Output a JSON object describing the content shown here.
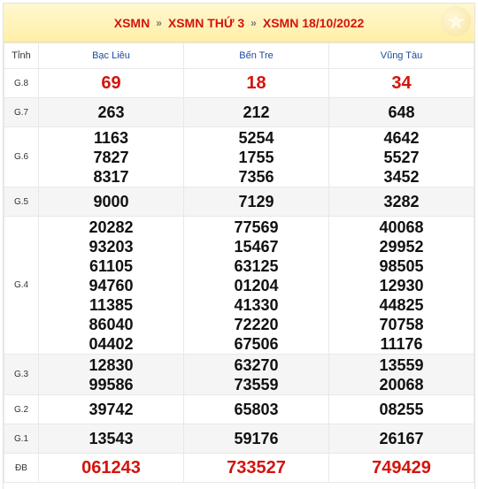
{
  "breadcrumb": {
    "items": [
      "XSMN",
      "XSMN THỨ 3",
      "XSMN 18/10/2022"
    ],
    "separator": "»"
  },
  "table": {
    "header_label": "Tỉnh",
    "provinces": [
      "Bạc Liêu",
      "Bến Tre",
      "Vũng Tàu"
    ],
    "rows": [
      {
        "label": "G.8",
        "values": [
          [
            "69"
          ],
          [
            "18"
          ],
          [
            "34"
          ]
        ],
        "highlight": true
      },
      {
        "label": "G.7",
        "values": [
          [
            "263"
          ],
          [
            "212"
          ],
          [
            "648"
          ]
        ]
      },
      {
        "label": "G.6",
        "values": [
          [
            "1163",
            "7827",
            "8317"
          ],
          [
            "5254",
            "1755",
            "7356"
          ],
          [
            "4642",
            "5527",
            "3452"
          ]
        ]
      },
      {
        "label": "G.5",
        "values": [
          [
            "9000"
          ],
          [
            "7129"
          ],
          [
            "3282"
          ]
        ]
      },
      {
        "label": "G.4",
        "values": [
          [
            "20282",
            "93203",
            "61105",
            "94760",
            "11385",
            "86040",
            "04402"
          ],
          [
            "77569",
            "15467",
            "63125",
            "01204",
            "41330",
            "72220",
            "67506"
          ],
          [
            "40068",
            "29952",
            "98505",
            "12930",
            "44825",
            "70758",
            "11176"
          ]
        ]
      },
      {
        "label": "G.3",
        "values": [
          [
            "12830",
            "99586"
          ],
          [
            "63270",
            "73559"
          ],
          [
            "13559",
            "20068"
          ]
        ]
      },
      {
        "label": "G.2",
        "values": [
          [
            "39742"
          ],
          [
            "65803"
          ],
          [
            "08255"
          ]
        ]
      },
      {
        "label": "G.1",
        "values": [
          [
            "13543"
          ],
          [
            "59176"
          ],
          [
            "26167"
          ]
        ]
      },
      {
        "label": "ĐB",
        "values": [
          [
            "061243"
          ],
          [
            "733527"
          ],
          [
            "749429"
          ]
        ],
        "highlight": true
      }
    ]
  },
  "colors": {
    "accent_red": "#d4140c",
    "province_blue": "#1b4aa0",
    "header_bg": "#ffefa8"
  },
  "icons": {
    "header_badge": "star-icon"
  }
}
